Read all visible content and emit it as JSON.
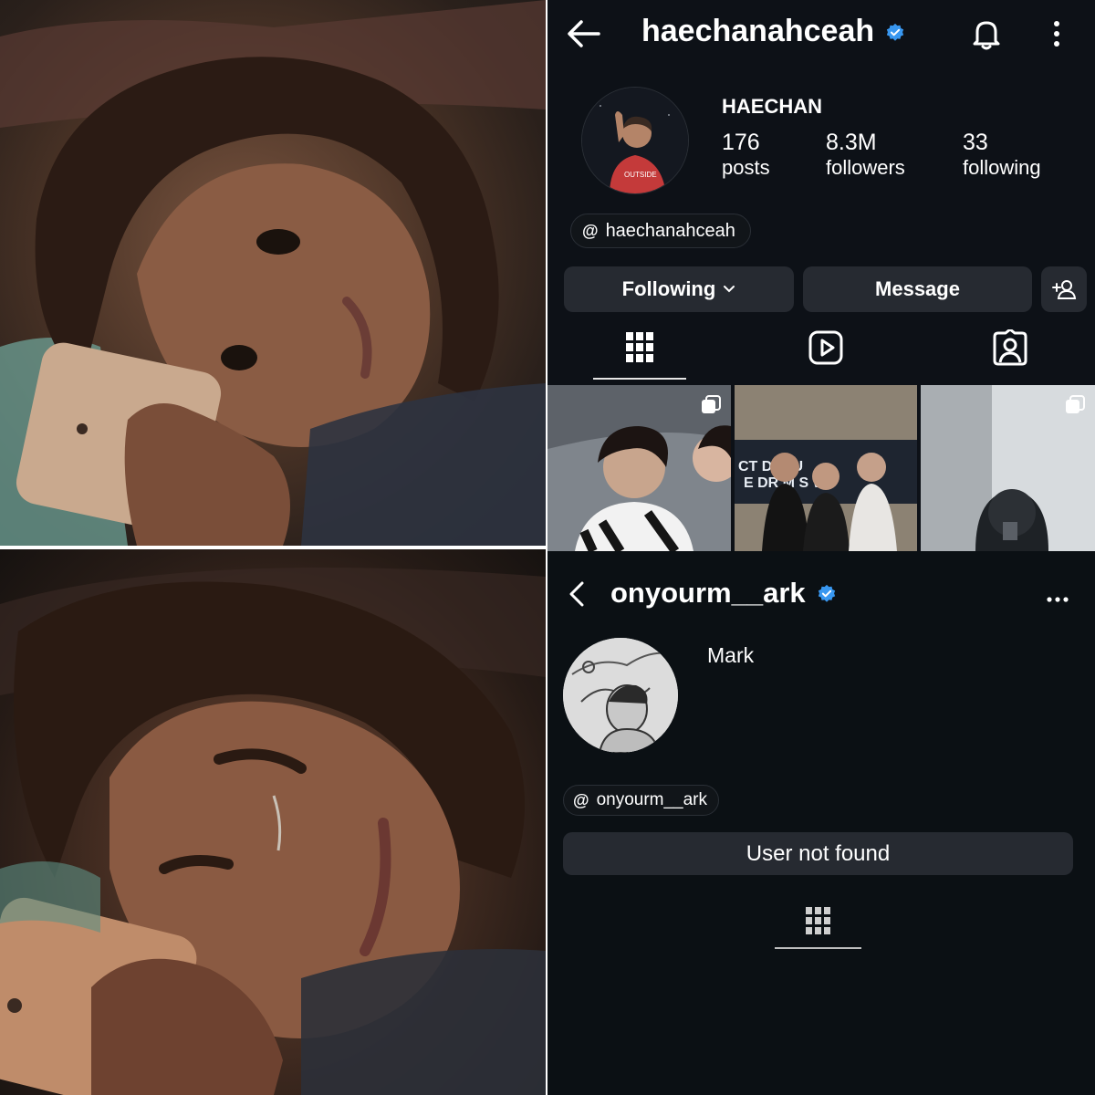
{
  "profile_one": {
    "username": "haechanahceah",
    "display_name": "HAECHAN",
    "stats": [
      {
        "value": "176",
        "label": "posts"
      },
      {
        "value": "8.3M",
        "label": "followers"
      },
      {
        "value": "33",
        "label": "following"
      }
    ],
    "threads_handle": "haechanahceah",
    "following_button": "Following",
    "message_button": "Message",
    "avatar_shirt_text": "OUTSIDE",
    "icons": [
      "back-arrow-icon",
      "verified-badge-icon",
      "bell-icon",
      "more-vertical-icon",
      "add-person-icon",
      "grid-icon",
      "reels-icon",
      "tagged-icon"
    ],
    "accent_color": "#3897f0",
    "thumbnails": [
      {
        "icon": "multi-post-icon"
      },
      {
        "caption": "CT D M U\nE DR M S W"
      },
      {
        "icon": "multi-post-icon"
      }
    ]
  },
  "profile_two": {
    "username": "onyourm__ark",
    "display_name": "Mark",
    "threads_handle": "onyourm__ark",
    "status_button": "User not found",
    "icons": [
      "back-chevron-icon",
      "verified-badge-icon",
      "more-horizontal-icon",
      "grid-icon"
    ]
  }
}
